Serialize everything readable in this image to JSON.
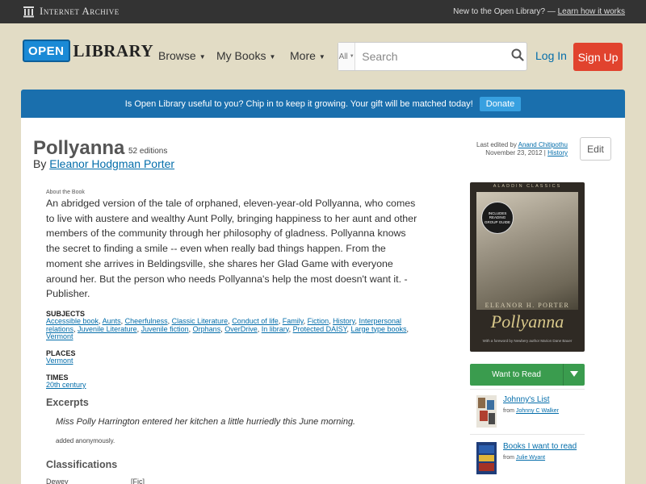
{
  "ia_bar": {
    "logo_text": "Internet Archive",
    "prompt": "New to the Open Library? —",
    "link": "Learn how it works"
  },
  "header": {
    "logo_open": "OPEN",
    "logo_library": "LIBRARY",
    "nav": [
      {
        "label": "Browse"
      },
      {
        "label": "My Books"
      },
      {
        "label": "More"
      }
    ],
    "search_scope": "All",
    "search_placeholder": "Search",
    "login": "Log In",
    "signup": "Sign Up"
  },
  "donate": {
    "message": "Is Open Library useful to you? Chip in to keep it growing. Your gift will be matched today!",
    "button": "Donate"
  },
  "book": {
    "title": "Pollyanna",
    "editions": "52 editions",
    "by": "By",
    "author": "Eleanor Hodgman Porter",
    "last_edited_prefix": "Last edited by",
    "last_edited_by": "Anand Chitipothu",
    "last_edited_date": "November 23, 2012 |",
    "history": "History",
    "edit_button": "Edit",
    "about_label": "About the Book",
    "description": "An abridged version of the tale of orphaned, eleven-year-old Pollyanna, who comes to live with austere and wealthy Aunt Polly, bringing happiness to her aunt and other members of the community through her philosophy of gladness. Pollyanna knows the secret to finding a smile -- even when really bad things happen. From the moment she arrives in Beldingsville, she shares her Glad Game with everyone around her. But the person who needs Pollyanna's help the most doesn't want it. - Publisher."
  },
  "subjects": {
    "heading": "Subjects",
    "items": [
      "Accessible book",
      "Aunts",
      "Cheerfulness",
      "Classic Literature",
      "Conduct of life",
      "Family",
      "Fiction",
      "History",
      "Interpersonal relations",
      "Juvenile Literature",
      "Juvenile fiction",
      "Orphans",
      "OverDrive",
      "In library",
      "Protected DAISY",
      "Large type books",
      "Vermont"
    ]
  },
  "places": {
    "heading": "Places",
    "items": [
      "Vermont"
    ]
  },
  "times": {
    "heading": "Times",
    "items": [
      "20th century"
    ]
  },
  "excerpts": {
    "heading": "Excerpts",
    "text": "Miss Polly Harrington entered her kitchen a little hurriedly this June morning.",
    "added": "added anonymously."
  },
  "classifications": {
    "heading": "Classifications",
    "dewey_label": "Dewey",
    "dewey_value": "[Fic]"
  },
  "cover": {
    "series": "ALADDIN CLASSICS",
    "badge": "INCLUDES READING GROUP GUIDE",
    "author": "ELEANOR H. PORTER",
    "title": "Pollyanna",
    "foreword": "With a foreword by Newbery author Marion Dane Bauer"
  },
  "sidebar": {
    "want_to_read": "Want to Read",
    "lists": [
      {
        "title": "Johnny's List",
        "from": "from",
        "owner": "Johnny C Walker"
      },
      {
        "title": "Books I want to read",
        "from": "from",
        "owner": "Julie Wyant"
      }
    ]
  },
  "colors": {
    "ia_bar": "#333333",
    "page_bg": "#e2dcc5",
    "donate_bg": "#1a6fad",
    "signup_bg": "#e1432e",
    "want_to_read_bg": "#3a9c4e",
    "link": "#036daa"
  }
}
